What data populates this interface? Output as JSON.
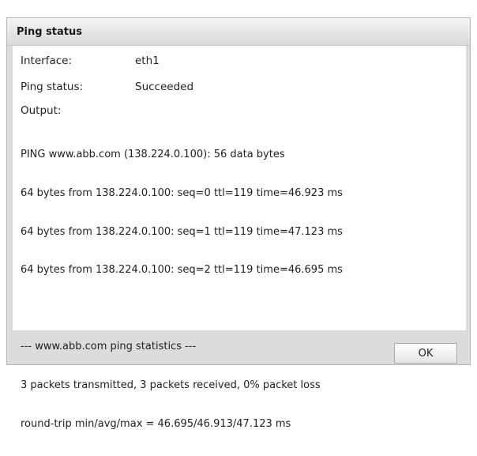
{
  "dialog": {
    "title": "Ping status",
    "interface": {
      "label": "Interface:",
      "value": "eth1"
    },
    "status": {
      "label": "Ping status:",
      "value": "Succeeded"
    },
    "output_label": "Output:",
    "output_lines": [
      "PING www.abb.com (138.224.0.100): 56 data bytes",
      "64 bytes from 138.224.0.100: seq=0 ttl=119 time=46.923 ms",
      "64 bytes from 138.224.0.100: seq=1 ttl=119 time=47.123 ms",
      "64 bytes from 138.224.0.100: seq=2 ttl=119 time=46.695 ms",
      "",
      "--- www.abb.com ping statistics ---",
      "3 packets transmitted, 3 packets received, 0% packet loss",
      "round-trip min/avg/max = 46.695/46.913/47.123 ms"
    ],
    "ok_label": "OK"
  }
}
